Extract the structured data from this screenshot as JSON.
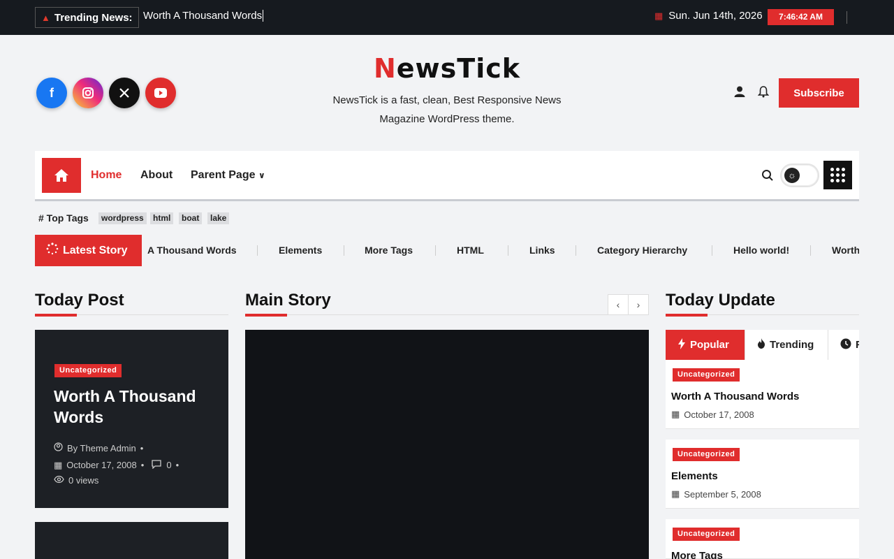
{
  "topbar": {
    "trending_label": "Trending News:",
    "trending_headline": "Worth A Thousand Words",
    "date": "Sun. Jun 14th, 2026",
    "time": "7:46:42 AM"
  },
  "header": {
    "logo_first": "N",
    "logo_rest": "ewsTick",
    "tagline": "NewsTick is a fast, clean, Best Responsive News Magazine WordPress theme.",
    "subscribe_label": "Subscribe",
    "social": [
      "facebook-icon",
      "instagram-icon",
      "x-icon",
      "youtube-icon"
    ]
  },
  "nav": {
    "items": [
      {
        "label": "Home"
      },
      {
        "label": "About"
      },
      {
        "label": "Parent Page"
      }
    ]
  },
  "tags": {
    "label": "# Top Tags",
    "items": [
      "wordpress",
      "html",
      "boat",
      "lake"
    ]
  },
  "latest": {
    "label": "Latest Story",
    "items": [
      "A Thousand Words",
      "Elements",
      "More Tags",
      "HTML",
      "Links",
      "Category Hierarchy",
      "Hello world!",
      "Worth"
    ]
  },
  "today_post": {
    "title": "Today Post",
    "category": "Uncategorized",
    "post_title": "Worth A Thousand Words",
    "author": "By Theme Admin",
    "date": "October 17, 2008",
    "comments": "0",
    "views": "0 views"
  },
  "main_story": {
    "title": "Main Story"
  },
  "today_update": {
    "title": "Today Update",
    "tabs": [
      "Popular",
      "Trending",
      "R"
    ],
    "posts": [
      {
        "category": "Uncategorized",
        "title": "Worth A Thousand Words",
        "date": "October 17, 2008"
      },
      {
        "category": "Uncategorized",
        "title": "Elements",
        "date": "September 5, 2008"
      },
      {
        "category": "Uncategorized",
        "title": "More Tags",
        "date": ""
      }
    ]
  },
  "colors": {
    "accent": "#e02d2d",
    "topbar": "#161a1f",
    "dark_card": "#1d2025"
  }
}
